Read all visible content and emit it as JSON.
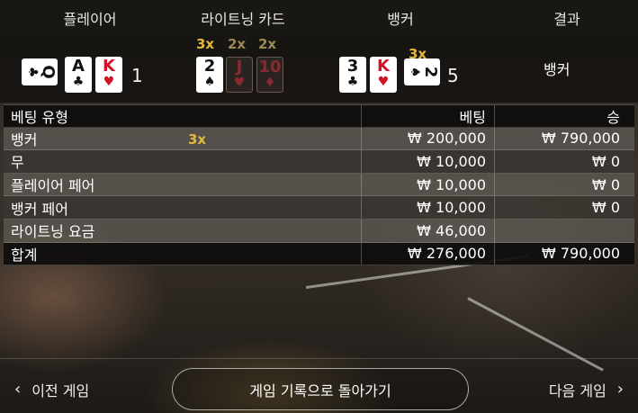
{
  "header": {
    "player": "플레이어",
    "lightning_cards": "라이트닝 카드",
    "banker": "뱅커",
    "result": "결과"
  },
  "round": {
    "player_cards": [
      {
        "rank": "Q",
        "suit": "♣",
        "color": "black",
        "rotated": true
      },
      {
        "rank": "A",
        "suit": "♣",
        "color": "black",
        "rotated": false
      },
      {
        "rank": "K",
        "suit": "♥",
        "color": "red",
        "rotated": false
      }
    ],
    "player_score": "1",
    "lightning_cards": [
      {
        "rank": "2",
        "suit": "♠",
        "multiplier": "3x",
        "active": true
      },
      {
        "rank": "J",
        "suit": "♥",
        "multiplier": "2x",
        "active": false
      },
      {
        "rank": "10",
        "suit": "♦",
        "multiplier": "2x",
        "active": false
      }
    ],
    "banker_cards": [
      {
        "rank": "3",
        "suit": "♣",
        "color": "black",
        "rotated": false
      },
      {
        "rank": "K",
        "suit": "♥",
        "color": "red",
        "rotated": false
      },
      {
        "rank": "2",
        "suit": "♠",
        "color": "black",
        "rotated": true
      }
    ],
    "banker_multiplier": "3x",
    "banker_score": "5",
    "result": "뱅커"
  },
  "table": {
    "headers": {
      "type": "베팅 유형",
      "bet": "베팅",
      "win": "승"
    },
    "rows": [
      {
        "type": "뱅커",
        "multiplier": "3x",
        "bet": "₩ 200,000",
        "win": "₩ 790,000"
      },
      {
        "type": "무",
        "multiplier": "",
        "bet": "₩ 10,000",
        "win": "₩ 0"
      },
      {
        "type": "플레이어 페어",
        "multiplier": "",
        "bet": "₩ 10,000",
        "win": "₩ 0"
      },
      {
        "type": "뱅커 페어",
        "multiplier": "",
        "bet": "₩ 10,000",
        "win": "₩ 0"
      },
      {
        "type": "라이트닝 요금",
        "multiplier": "",
        "bet": "₩ 46,000",
        "win": ""
      }
    ],
    "total": {
      "type": "합계",
      "bet": "₩ 276,000",
      "win": "₩ 790,000"
    }
  },
  "footer": {
    "prev": "이전 게임",
    "back": "게임 기록으로 돌아가기",
    "next": "다음 게임"
  },
  "colors": {
    "gold": "#e3b73a",
    "red_suit": "#d0142a"
  }
}
